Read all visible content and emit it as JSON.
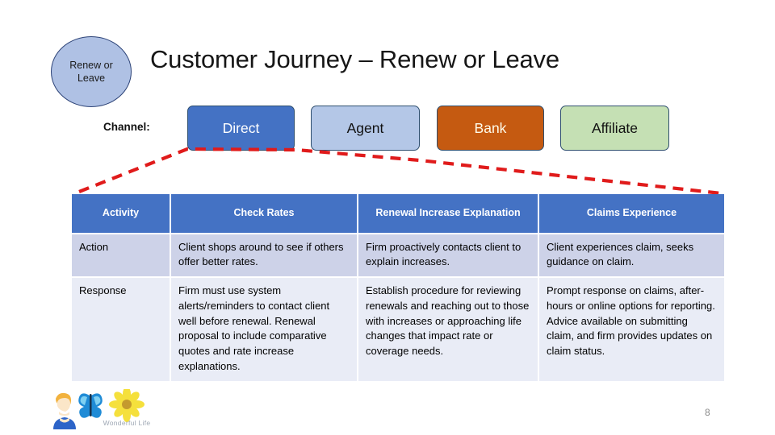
{
  "slide": {
    "title": "Customer Journey – Renew or Leave",
    "page_number": "8"
  },
  "stage_circle": {
    "label_line1": "Renew or",
    "label_line2": "Leave",
    "fill_color": "#AFC1E4",
    "border_color": "#2E4478"
  },
  "channel": {
    "label": "Channel:",
    "boxes": [
      {
        "name": "direct",
        "label": "Direct",
        "fill": "#4472C4",
        "text_color": "#FFFFFF"
      },
      {
        "name": "agent",
        "label": "Agent",
        "fill": "#B4C7E7",
        "text_color": "#111111"
      },
      {
        "name": "bank",
        "label": "Bank",
        "fill": "#C55A11",
        "text_color": "#FFFBEA"
      },
      {
        "name": "affiliate",
        "label": "Affiliate",
        "fill": "#C5E0B4",
        "text_color": "#111111"
      }
    ]
  },
  "connector": {
    "style": "dashed",
    "color": "#E01B1B"
  },
  "table": {
    "headers": [
      "Activity",
      "Check Rates",
      "Renewal Increase Explanation",
      "Claims Experience"
    ],
    "header_fill": "#4472C4",
    "rows": [
      {
        "label": "Action",
        "fill": "#CDD2E8",
        "cells": [
          "Client shops around to see if others offer better rates.",
          "Firm proactively contacts client to explain increases.",
          "Client experiences claim, seeks guidance on claim."
        ]
      },
      {
        "label": "Response",
        "fill": "#E9ECF6",
        "cells": [
          "Firm must use system alerts/reminders to contact client well before renewal. Renewal proposal to include comparative quotes and rate increase explanations.",
          "Establish procedure for reviewing renewals and reaching out to those with increases or approaching life changes that impact rate or coverage needs.",
          "Prompt response on claims, after-hours or online options for reporting. Advice available on submitting claim, and firm provides updates on claim status."
        ]
      }
    ]
  },
  "footer": {
    "logo_text": "Wonderful Life",
    "logo_icons": [
      "person-icon",
      "butterfly-icon",
      "flower-icon"
    ]
  }
}
